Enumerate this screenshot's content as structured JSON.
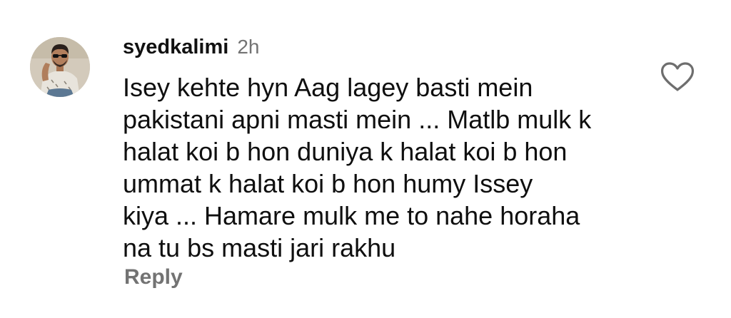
{
  "comment": {
    "username": "syedkalimi",
    "timestamp": "2h",
    "text": "Isey kehte hyn Aag lagey basti mein\npakistani apni masti mein ... Matlb mulk k\nhalat koi b hon duniya k halat koi b hon\nummat k halat koi b hon humy Issey\nkiya ... Hamare mulk me to nahe horaha\nna tu bs masti jari rakhu",
    "reply_label": "Reply",
    "like_icon": "heart-outline-icon"
  },
  "colors": {
    "username": "#111111",
    "muted": "#737373",
    "text": "#0f0f0f",
    "background": "#ffffff"
  }
}
